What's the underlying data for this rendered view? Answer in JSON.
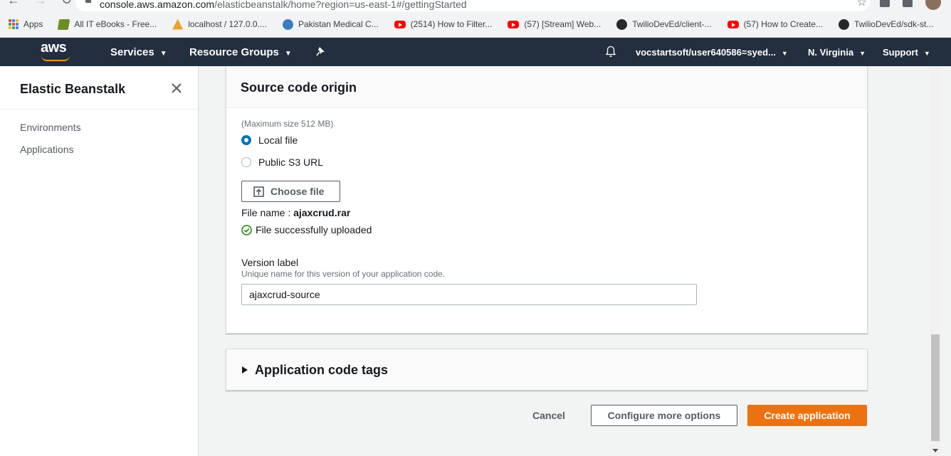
{
  "browser": {
    "url_host": "console.aws.amazon.com",
    "url_path": "/elasticbeanstalk/home?region=us-east-1#/gettingStarted",
    "bookmarks": [
      {
        "label": "Apps",
        "icon": "apps-grid-icon"
      },
      {
        "label": "All IT eBooks - Free...",
        "icon": "book-icon"
      },
      {
        "label": "localhost / 127.0.0....",
        "icon": "phpmyadmin-icon"
      },
      {
        "label": "Pakistan Medical C...",
        "icon": "pmc-icon"
      },
      {
        "label": "(2514) How to Filter...",
        "icon": "youtube-icon"
      },
      {
        "label": "(57) [Stream] Web...",
        "icon": "youtube-icon"
      },
      {
        "label": "TwilioDevEd/client-...",
        "icon": "github-icon"
      },
      {
        "label": "(57) How to Create...",
        "icon": "youtube-icon"
      },
      {
        "label": "TwilioDevEd/sdk-st...",
        "icon": "github-icon"
      }
    ]
  },
  "aws_header": {
    "logo": "aws",
    "services": "Services",
    "resource_groups": "Resource Groups",
    "account": "vocstartsoft/user640586=syed...",
    "region": "N. Virginia",
    "support": "Support"
  },
  "sidebar": {
    "title": "Elastic Beanstalk",
    "items": [
      {
        "label": "Environments"
      },
      {
        "label": "Applications"
      }
    ]
  },
  "source_panel": {
    "title": "Source code origin",
    "max_size_hint": "(Maximum size 512 MB)",
    "options": [
      {
        "label": "Local file",
        "selected": true
      },
      {
        "label": "Public S3 URL",
        "selected": false
      }
    ],
    "choose_file_label": "Choose file",
    "file_name_prefix": "File name :",
    "file_name": "ajaxcrud.rar",
    "upload_status": "File successfully uploaded",
    "version_label": "Version label",
    "version_desc": "Unique name for this version of your application code.",
    "version_value": "ajaxcrud-source"
  },
  "tags_panel": {
    "title": "Application code tags"
  },
  "actions": {
    "cancel": "Cancel",
    "configure": "Configure more options",
    "create": "Create application"
  },
  "colors": {
    "aws_nav": "#232f3e",
    "primary_button": "#ec7211",
    "radio_selected": "#0073bb",
    "success_green": "#1d8102"
  }
}
